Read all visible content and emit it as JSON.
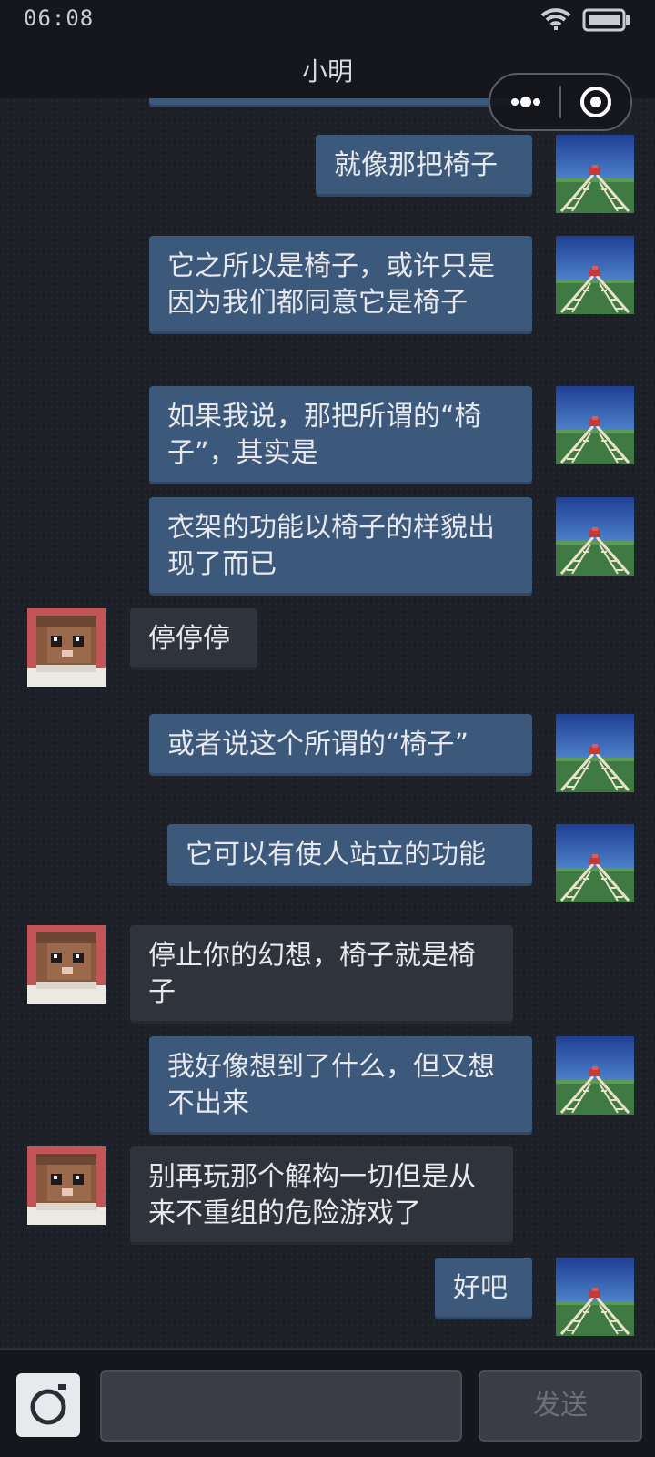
{
  "status_bar": {
    "time": "06:08",
    "icons": [
      "wifi-icon",
      "battery-icon"
    ]
  },
  "header": {
    "title": "小明",
    "icons": [
      "more-dots-icon",
      "close-target-icon"
    ]
  },
  "colors": {
    "outgoing_bubble": "#3c587b",
    "incoming_bubble": "#2f333b",
    "background": "#1d2027"
  },
  "messages": [
    {
      "from": "me",
      "text": "就像那把椅子"
    },
    {
      "from": "me",
      "text": "它之所以是椅子，或许只是因为我们都同意它是椅子"
    },
    {
      "from": "me",
      "text": "如果我说，那把所谓的“椅子”，其实是"
    },
    {
      "from": "me",
      "text": "衣架的功能以椅子的样貌出现了而已"
    },
    {
      "from": "friend",
      "text": "停停停"
    },
    {
      "from": "me",
      "text": "或者说这个所谓的“椅子”"
    },
    {
      "from": "me",
      "text": "它可以有使人站立的功能"
    },
    {
      "from": "friend",
      "text": "停止你的幻想，椅子就是椅子"
    },
    {
      "from": "me",
      "text": "我好像想到了什么，但又想不出来"
    },
    {
      "from": "friend",
      "text": "别再玩那个解构一切但是从来不重组的危险游戏了"
    },
    {
      "from": "me",
      "text": "好吧"
    }
  ],
  "input_bar": {
    "input_value": "",
    "send_label": "发送",
    "icons": [
      "camera-icon"
    ]
  }
}
